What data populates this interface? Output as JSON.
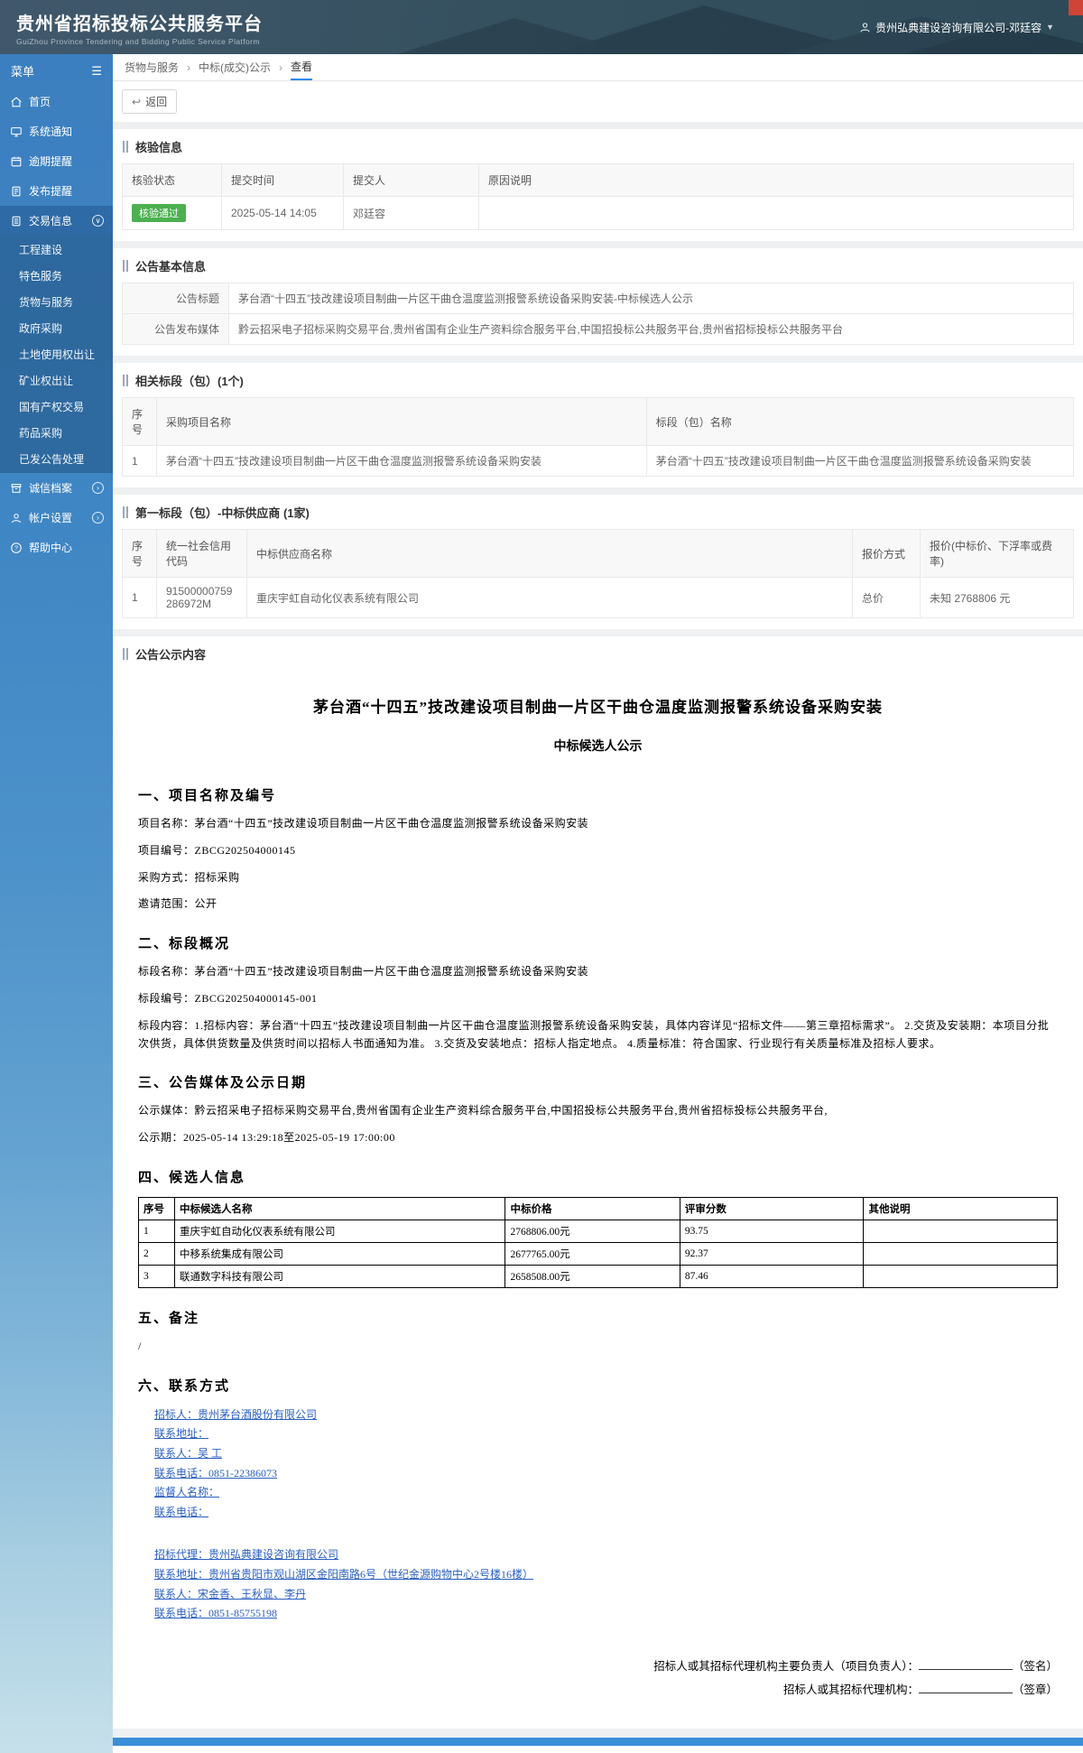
{
  "header": {
    "title": "贵州省招标投标公共服务平台",
    "subtitle": "GuiZhou Province Tendering and Bidding Public Service Platform",
    "user": "贵州弘典建设咨询有限公司-邓廷容"
  },
  "sidebar": {
    "menu_label": "菜单",
    "items": [
      {
        "label": "首页"
      },
      {
        "label": "系统通知"
      },
      {
        "label": "逾期提醒"
      },
      {
        "label": "发布提醒"
      },
      {
        "label": "交易信息"
      }
    ],
    "trade_children": [
      "工程建设",
      "特色服务",
      "货物与服务",
      "政府采购",
      "土地使用权出让",
      "矿业权出让",
      "国有产权交易",
      "药品采购",
      "已发公告处理"
    ],
    "bottom_items": [
      {
        "label": "诚信档案"
      },
      {
        "label": "帐户设置"
      },
      {
        "label": "帮助中心"
      }
    ]
  },
  "breadcrumb": {
    "items": [
      "货物与服务",
      "中标(成交)公示",
      "查看"
    ]
  },
  "toolbar": {
    "back_label": "返回"
  },
  "verify": {
    "section_title": "核验信息",
    "headers": [
      "核验状态",
      "提交时间",
      "提交人",
      "原因说明"
    ],
    "row": {
      "status": "核验通过",
      "time": "2025-05-14 14:05",
      "submitter": "邓廷容",
      "reason": ""
    }
  },
  "announce": {
    "section_title": "公告基本信息",
    "title_label": "公告标题",
    "title_value": "茅台酒“十四五”技改建设项目制曲一片区干曲仓温度监测报警系统设备采购安装-中标候选人公示",
    "media_label": "公告发布媒体",
    "media_value": "黔云招采电子招标采购交易平台,贵州省国有企业生产资料综合服务平台,中国招投标公共服务平台,贵州省招标投标公共服务平台"
  },
  "rel": {
    "section_title": "相关标段（包）(1个)",
    "headers": [
      "序号",
      "采购项目名称",
      "标段（包）名称"
    ],
    "rows": [
      [
        "1",
        "茅台酒“十四五”技改建设项目制曲一片区干曲仓温度监测报警系统设备采购安装",
        "茅台酒“十四五”技改建设项目制曲一片区干曲仓温度监测报警系统设备采购安装"
      ]
    ]
  },
  "winner": {
    "section_title": "第一标段（包）-中标供应商 (1家)",
    "headers": [
      "序号",
      "统一社会信用代码",
      "中标供应商名称",
      "报价方式",
      "报价(中标价、下浮率或费率)"
    ],
    "rows": [
      [
        "1",
        "91500000759286972M",
        "重庆宇虹自动化仪表系统有限公司",
        "总价",
        "未知 2768806 元"
      ]
    ]
  },
  "doc": {
    "section_title": "公告公示内容",
    "title": "茅台酒“十四五”技改建设项目制曲一片区干曲仓温度监测报警系统设备采购安装",
    "subtitle": "中标候选人公示",
    "s1_title": "一、项目名称及编号",
    "s1_lines": [
      "项目名称：茅台酒“十四五”技改建设项目制曲一片区干曲仓温度监测报警系统设备采购安装",
      "项目编号：ZBCG202504000145",
      "采购方式：招标采购",
      "邀请范围：公开"
    ],
    "s2_title": "二、标段概况",
    "s2_lines": [
      "标段名称：茅台酒“十四五”技改建设项目制曲一片区干曲仓温度监测报警系统设备采购安装",
      "标段编号：ZBCG202504000145-001",
      "标段内容：1.招标内容：茅台酒“十四五”技改建设项目制曲一片区干曲仓温度监测报警系统设备采购安装，具体内容详见“招标文件——第三章招标需求”。 2.交货及安装期：本项目分批次供货，具体供货数量及供货时间以招标人书面通知为准。 3.交货及安装地点：招标人指定地点。 4.质量标准：符合国家、行业现行有关质量标准及招标人要求。"
    ],
    "s3_title": "三、公告媒体及公示日期",
    "s3_lines": [
      "公示媒体：黔云招采电子招标采购交易平台,贵州省国有企业生产资料综合服务平台,中国招投标公共服务平台,贵州省招标投标公共服务平台,",
      "公示期：2025-05-14 13:29:18至2025-05-19 17:00:00"
    ],
    "s4_title": "四、候选人信息",
    "s4_table": {
      "headers": [
        "序号",
        "中标候选人名称",
        "中标价格",
        "评审分数",
        "其他说明"
      ],
      "rows": [
        [
          "1",
          "重庆宇虹自动化仪表系统有限公司",
          "2768806.00元",
          "93.75",
          ""
        ],
        [
          "2",
          "中移系统集成有限公司",
          "2677765.00元",
          "92.37",
          ""
        ],
        [
          "3",
          "联通数字科技有限公司",
          "2658508.00元",
          "87.46",
          ""
        ]
      ]
    },
    "s5_title": "五、备注",
    "s5_lines": [
      "/"
    ],
    "s6_title": "六、联系方式",
    "contact_links": [
      "招标人：贵州茅台酒股份有限公司",
      "联系地址：",
      "联系人：吴 工",
      "联系电话：0851-22386073",
      "监督人名称：",
      "联系电话："
    ],
    "agent_links": [
      "招标代理：贵州弘典建设咨询有限公司",
      "联系地址：贵州省贵阳市观山湖区金阳南路6号（世纪金源购物中心2号楼16楼）",
      "联系人：宋金香、王秋显、李丹",
      "联系电话：0851-85755198"
    ],
    "sign1_label": "招标人或其招标代理机构主要负责人（项目负责人）：",
    "sign1_suffix": "（签名）",
    "sign2_label": "招标人或其招标代理机构：",
    "sign2_suffix": "（签章）"
  },
  "colors": {
    "accent_blue": "#2d8cf0",
    "success_green": "#4cb050",
    "sidebar_blue": "#3c7fc0",
    "header_dark": "#35505f",
    "corner_red": "#cf4436"
  }
}
